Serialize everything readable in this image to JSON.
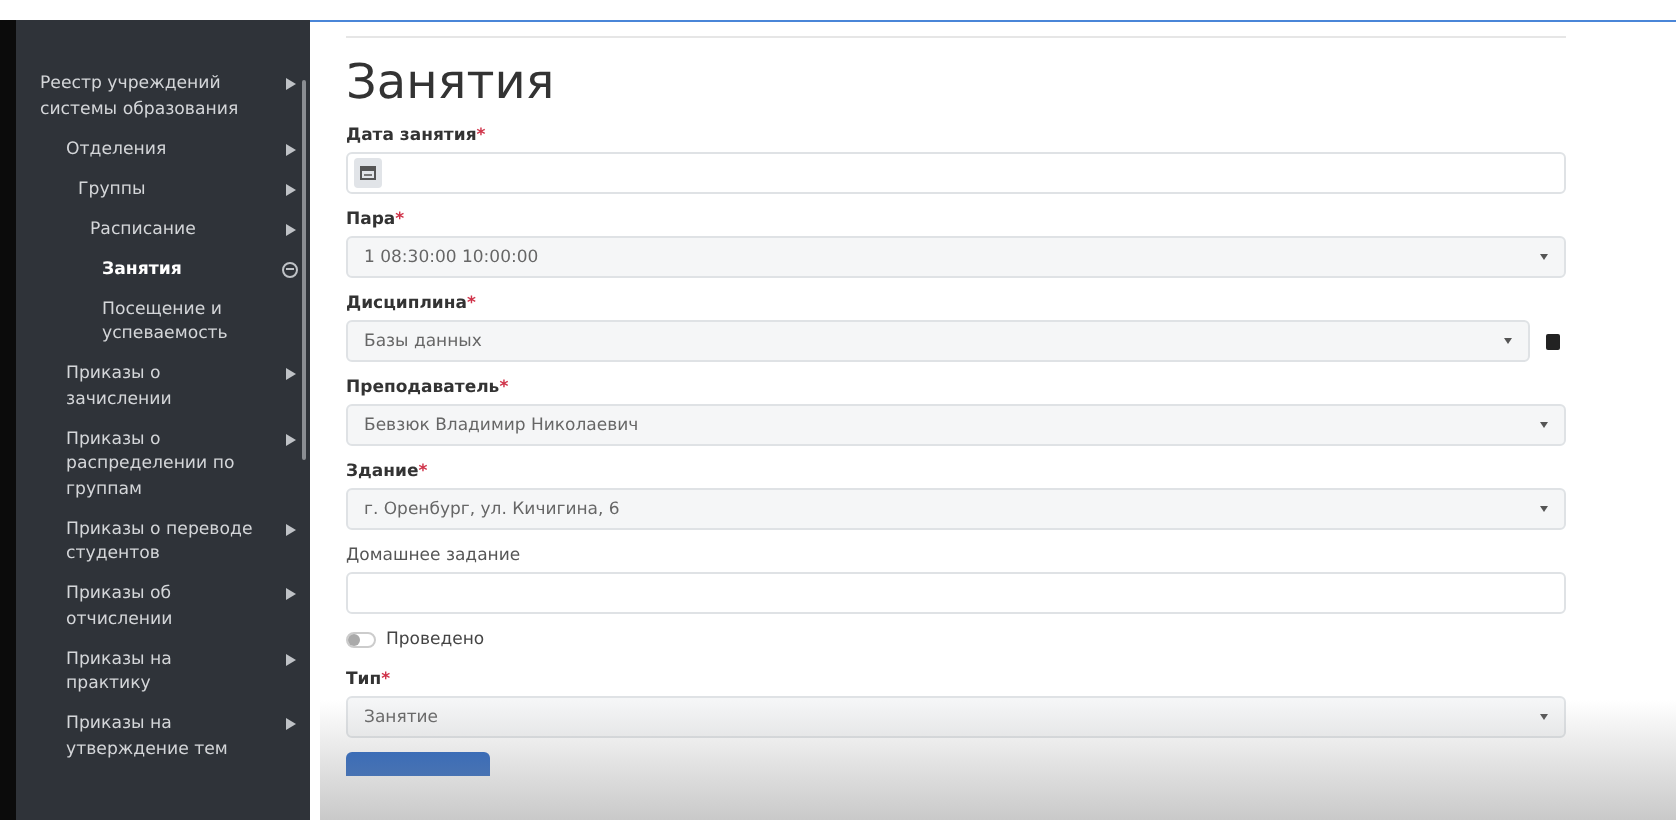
{
  "sidebar": {
    "items": [
      {
        "label": "Реестр учреждений системы образования",
        "kind": "submenu",
        "selected": false,
        "children": [
          {
            "label": "Отделения",
            "kind": "submenu",
            "selected": false,
            "children": [
              {
                "label": "Группы",
                "kind": "submenu",
                "selected": false,
                "children": [
                  {
                    "label": "Расписание",
                    "kind": "submenu",
                    "selected": false,
                    "children": [
                      {
                        "label": "Занятия",
                        "kind": "link",
                        "selected": true
                      },
                      {
                        "label": "Посещение и успеваемость",
                        "kind": "link",
                        "selected": false
                      }
                    ]
                  }
                ]
              }
            ]
          },
          {
            "label": "Приказы о зачислении",
            "kind": "submenu",
            "selected": false
          },
          {
            "label": "Приказы о распределении по группам",
            "kind": "submenu",
            "selected": false
          },
          {
            "label": "Приказы о переводе студентов",
            "kind": "submenu",
            "selected": false
          },
          {
            "label": "Приказы об отчислении",
            "kind": "submenu",
            "selected": false
          },
          {
            "label": "Приказы на практику",
            "kind": "submenu",
            "selected": false
          },
          {
            "label": "Приказы на утверждение тем",
            "kind": "submenu",
            "selected": false
          }
        ]
      }
    ]
  },
  "form": {
    "title": "Занятия",
    "fields": [
      {
        "kind": "date",
        "label": "Дата занятия",
        "mark": "*"
      },
      {
        "kind": "select",
        "label": "Пара",
        "mark": "*",
        "value": "1 08:30:00 10:00:00"
      },
      {
        "kind": "select_add",
        "label": "Дисциплина",
        "mark": "*",
        "value": "Базы данных"
      },
      {
        "kind": "select",
        "label": "Преподаватель",
        "mark": "*",
        "value": "Бевзюк Владимир Николаевич"
      },
      {
        "kind": "select",
        "label": "Здание",
        "mark": "*",
        "value": "г. Оренбург, ул. Кичигина, 6"
      },
      {
        "kind": "text",
        "label": "Домашнее задание"
      },
      {
        "kind": "toggle",
        "label": "Проведено",
        "on": false
      },
      {
        "kind": "select",
        "label": "Тип",
        "mark": "*",
        "value": "Занятие"
      }
    ]
  }
}
